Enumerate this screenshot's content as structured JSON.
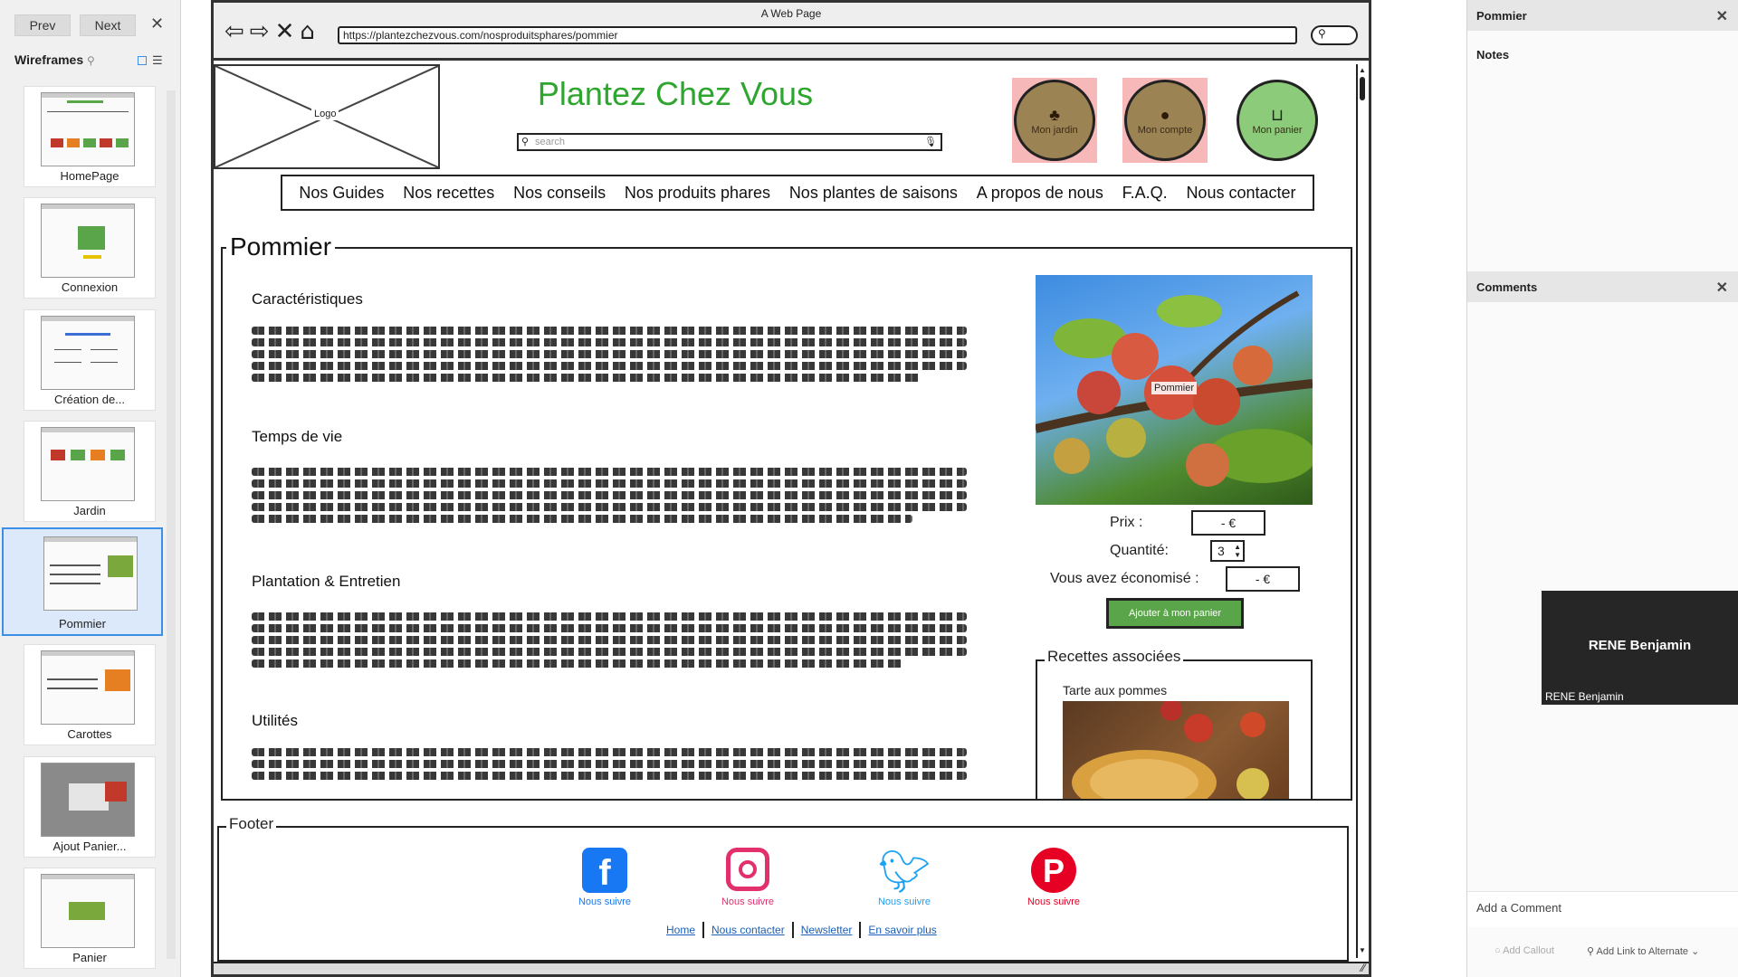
{
  "left_panel": {
    "prev_label": "Prev",
    "next_label": "Next",
    "title": "Wireframes",
    "pages": [
      {
        "label": "HomePage"
      },
      {
        "label": "Connexion"
      },
      {
        "label": "Création de..."
      },
      {
        "label": "Jardin"
      },
      {
        "label": "Pommier"
      },
      {
        "label": "Carottes"
      },
      {
        "label": "Ajout Panier..."
      },
      {
        "label": "Panier"
      }
    ],
    "selected_page": "Pommier"
  },
  "browser": {
    "window_title": "A Web Page",
    "url": "https://plantezchezvous.com/nosproduitsphares/pommier"
  },
  "page": {
    "logo_label": "Logo",
    "site_title": "Plantez Chez Vous",
    "search_placeholder": "search",
    "header_buttons": [
      {
        "label": "Mon jardin",
        "icon": "tree-icon"
      },
      {
        "label": "Mon compte",
        "icon": "user-icon"
      },
      {
        "label": "Mon panier",
        "icon": "basket-icon"
      }
    ],
    "nav": [
      "Nos Guides",
      "Nos recettes",
      "Nos conseils",
      "Nos produits phares",
      "Nos plantes de saisons",
      "A propos de nous",
      "F.A.Q.",
      "Nous contacter"
    ],
    "main_title": "Pommier",
    "sections": [
      {
        "title": "Caractéristiques"
      },
      {
        "title": "Temps de vie"
      },
      {
        "title": "Plantation & Entretien"
      },
      {
        "title": "Utilités"
      }
    ],
    "product_image_label": "Pommier",
    "price_label": "Prix :",
    "price_value": "- €",
    "quantity_label": "Quantité:",
    "quantity_value": "3",
    "savings_label": "Vous avez économisé :",
    "savings_value": "- €",
    "add_to_cart_label": "Ajouter à mon panier",
    "related_title": "Recettes associées",
    "related_recipe": "Tarte aux pommes",
    "footer_title": "Footer",
    "social": [
      {
        "name": "facebook-icon",
        "caption": "Nous suivre",
        "color": "#1877f2"
      },
      {
        "name": "instagram-icon",
        "caption": "Nous suivre",
        "color": "#e1306c"
      },
      {
        "name": "twitter-icon",
        "caption": "Nous suivre",
        "color": "#1da1f2"
      },
      {
        "name": "pinterest-icon",
        "caption": "Nous suivre",
        "color": "#e60023"
      }
    ],
    "footer_links": [
      "Home",
      "Nous contacter",
      "Newsletter",
      "En savoir plus"
    ]
  },
  "right_panel": {
    "notes_header": "Pommier",
    "notes_label": "Notes",
    "comments_header": "Comments",
    "add_comment_placeholder": "Add a Comment",
    "add_callout_label": "Add Callout",
    "add_link_label": "Add Link to Alternate"
  },
  "video_tile": {
    "name": "RENE Benjamin",
    "caption": "RENE Benjamin"
  },
  "colors": {
    "accent_green": "#2ea52e",
    "button_green": "#5aa54a",
    "circle_brown": "#9c8354",
    "selection_blue": "#3b8fe6"
  }
}
